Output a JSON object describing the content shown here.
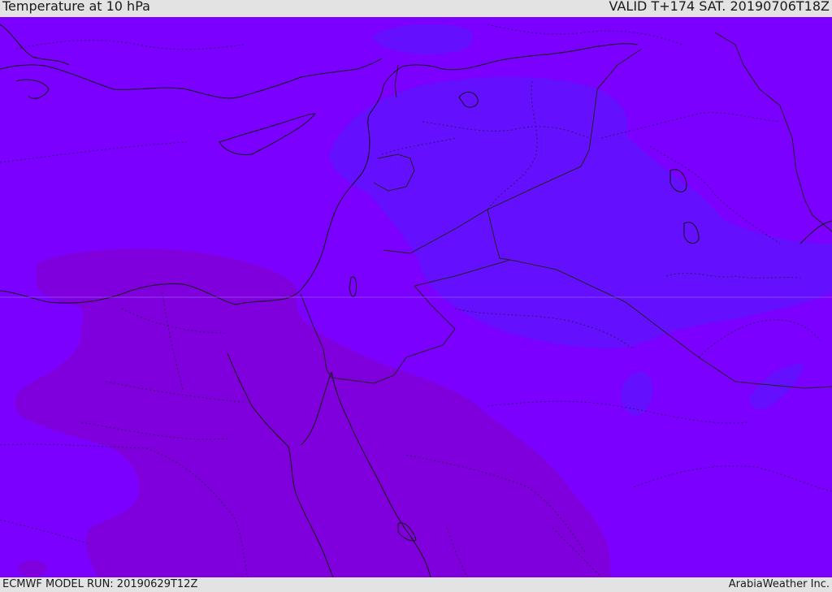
{
  "header": {
    "title": "Temperature at 10 hPa",
    "valid_time": "VALID T+174 SAT. 20190706T18Z"
  },
  "footer": {
    "model_run": "ECMWF MODEL RUN: 20190629T12Z",
    "credit": "ArabiaWeather Inc."
  },
  "map": {
    "colors": {
      "base_field": "#7b00ff",
      "cool_field": "#6410ff",
      "warm_field": "#8000dd",
      "coastline": "#111111",
      "border": "#222222"
    }
  }
}
